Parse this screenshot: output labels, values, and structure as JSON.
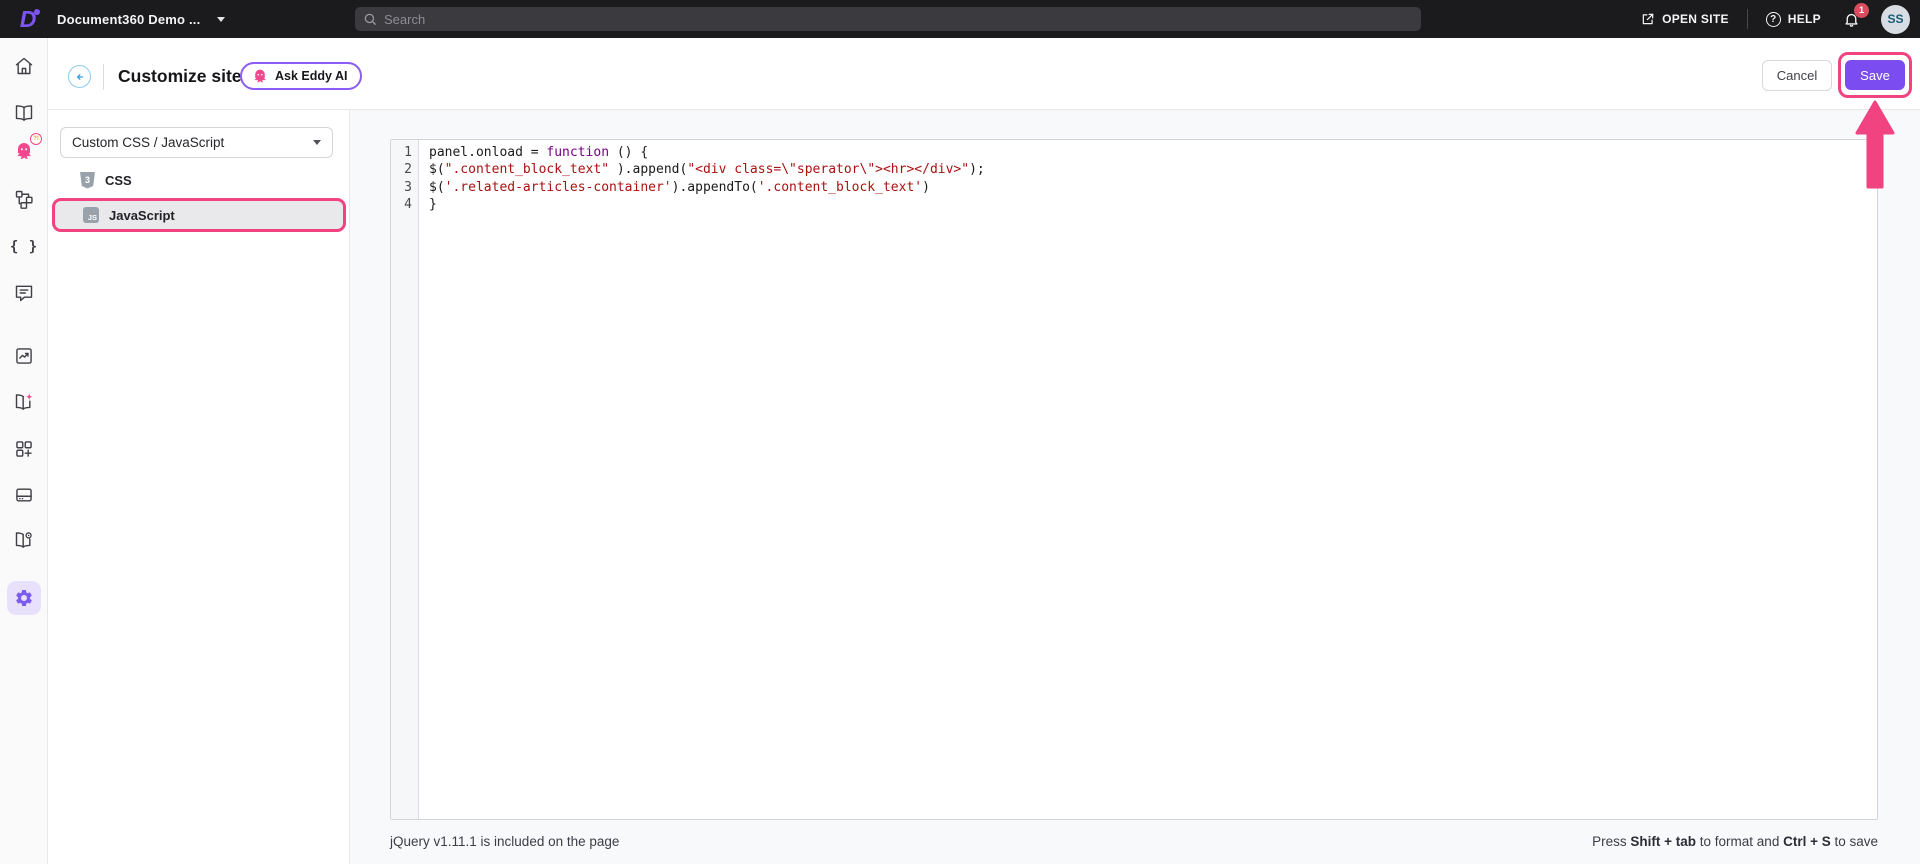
{
  "topbar": {
    "logo_glyph": "D",
    "brand": "Document360 Demo ...",
    "search_placeholder": "Search",
    "open_site": "OPEN SITE",
    "help": "HELP",
    "help_glyph": "?",
    "notification_count": "1",
    "avatar_initials": "SS"
  },
  "header": {
    "title": "Customize site",
    "ask_eddy": "Ask Eddy AI",
    "cancel": "Cancel",
    "save": "Save"
  },
  "sidebar": {
    "icons": [
      "home",
      "documentation",
      "eddy-ai",
      "categories",
      "api-docs",
      "feedback",
      "analytics",
      "kb-ai",
      "widgets",
      "drive",
      "kb-site",
      "settings"
    ],
    "active": "settings",
    "eddy_badge": "?!"
  },
  "panel": {
    "dropdown_value": "Custom CSS / JavaScript",
    "items": [
      {
        "icon": "css3-icon",
        "icon_glyph": "3",
        "label": "CSS",
        "selected": false
      },
      {
        "icon": "js-icon",
        "icon_glyph": "JS",
        "label": "JavaScript",
        "selected": true
      }
    ]
  },
  "editor": {
    "line_numbers": [
      "1",
      "2",
      "3",
      "4"
    ],
    "lines": [
      [
        {
          "c": "p",
          "t": "panel.onload = "
        },
        {
          "c": "k",
          "t": "function"
        },
        {
          "c": "p",
          "t": " () {"
        }
      ],
      [
        {
          "c": "p",
          "t": "$("
        },
        {
          "c": "s",
          "t": "\".content_block_text\""
        },
        {
          "c": "p",
          "t": " ).append("
        },
        {
          "c": "s",
          "t": "\"<div class=\\\"sperator\\\"><hr></div>\""
        },
        {
          "c": "p",
          "t": ");"
        }
      ],
      [
        {
          "c": "p",
          "t": "$("
        },
        {
          "c": "s",
          "t": "'.related-articles-container'"
        },
        {
          "c": "p",
          "t": ").appendTo("
        },
        {
          "c": "s",
          "t": "'.content_block_text'"
        },
        {
          "c": "p",
          "t": ")"
        }
      ],
      [
        {
          "c": "p",
          "t": "}"
        }
      ]
    ]
  },
  "footer": {
    "left": "jQuery v1.11.1 is included on the page",
    "right": {
      "p1": "Press ",
      "b1": "Shift + tab",
      "p2": " to format and ",
      "b2": "Ctrl + S",
      "p3": " to save"
    }
  },
  "colors": {
    "topbar_bg": "#1b1b1e",
    "accent_purple": "#7b4cf0",
    "highlight_pink": "#f0437f",
    "keyword": "#770088",
    "string": "#aa1111",
    "eddy_pink": "#f0478e"
  }
}
